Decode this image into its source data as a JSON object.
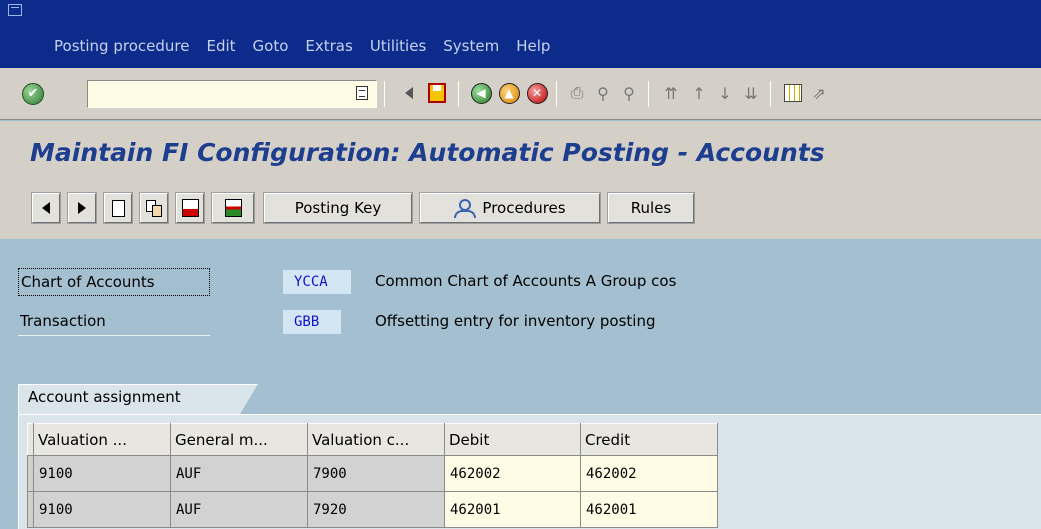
{
  "menubar": {
    "items": [
      "Posting procedure",
      "Edit",
      "Goto",
      "Extras",
      "Utilities",
      "System",
      "Help"
    ]
  },
  "toolbar": {
    "command_field_value": "",
    "icons": [
      "enter-icon",
      "command-field-dropdown-icon",
      "back-arrow-icon",
      "save-icon",
      "back-icon",
      "exit-icon",
      "cancel-icon",
      "print-icon",
      "find-icon",
      "find-next-icon",
      "first-page-icon",
      "previous-page-icon",
      "next-page-icon",
      "last-page-icon",
      "create-session-icon",
      "shortcut-icon"
    ]
  },
  "title": "Maintain FI Configuration: Automatic Posting - Accounts",
  "app_toolbar": {
    "posting_key_label": "Posting Key",
    "procedures_label": "Procedures",
    "rules_label": "Rules"
  },
  "header": {
    "chart_of_accounts": {
      "label": "Chart of Accounts",
      "value": "YCCA",
      "description": "Common Chart of Accounts A Group cos"
    },
    "transaction": {
      "label": "Transaction",
      "value": "GBB",
      "description": "Offsetting entry for inventory posting"
    }
  },
  "tab": {
    "label": "Account assignment"
  },
  "table": {
    "columns": [
      "Valuation ...",
      "General m...",
      "Valuation c...",
      "Debit",
      "Credit"
    ],
    "rows": [
      [
        "9100",
        "AUF",
        "7900",
        "462002",
        "462002"
      ],
      [
        "9100",
        "AUF",
        "7920",
        "462001",
        "462001"
      ]
    ]
  },
  "colors": {
    "menubar_bg": "#0c2b8b",
    "title_color": "#1d3d8f",
    "screen_bg": "#a4c0d0",
    "value_color": "#1212c8"
  }
}
